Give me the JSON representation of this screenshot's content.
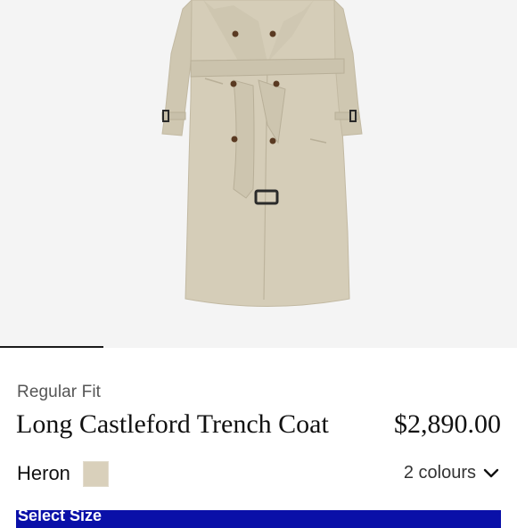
{
  "product": {
    "fit": "Regular Fit",
    "name": "Long Castleford Trench Coat",
    "price": "$2,890.00",
    "image_icon": "trench-coat-image"
  },
  "colour": {
    "name": "Heron",
    "swatch_color": "#d9d0bb",
    "count_label": "2 colours",
    "chevron_icon": "chevron-down-icon"
  },
  "size_button": {
    "label": "Select Size",
    "background": "#0a10a8"
  },
  "carousel": {
    "active_index": 1,
    "total": 5
  },
  "colors": {
    "coat": "#d5cdb8",
    "coat_shadow": "#c2b9a2",
    "buttons": "#5a3a22",
    "buckle": "#2a2a2a"
  }
}
